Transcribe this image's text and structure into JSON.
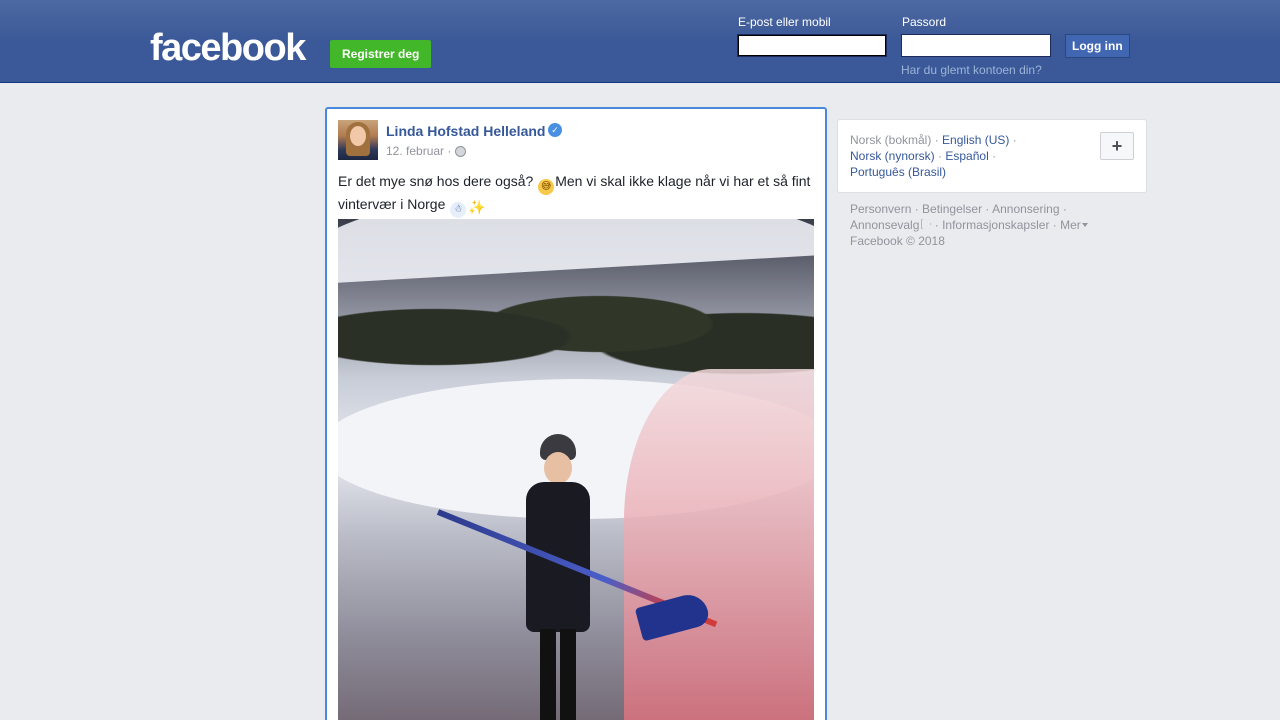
{
  "header": {
    "logo_text": "facebook",
    "register_label": "Registrer deg",
    "email_label": "E-post eller mobil",
    "email_value": "",
    "password_label": "Passord",
    "password_value": "",
    "login_label": "Logg inn",
    "forgot_label": "Har du glemt kontoen din?"
  },
  "post": {
    "author": "Linda Hofstad Helleland",
    "verified": true,
    "date": "12. februar",
    "date_separator": "·",
    "text_part1": "Er det mye snø hos dere også?",
    "text_part2": "Men vi skal ikke klage når vi har et så fint vintervær i Norge",
    "emojis": [
      "grinning-sweat-emoji",
      "snowman-emoji",
      "sparkles-emoji"
    ]
  },
  "languages": {
    "current": "Norsk (bokmål)",
    "links": [
      "English (US)",
      "Norsk (nynorsk)",
      "Español",
      "Português (Brasil)"
    ],
    "more_label": "+"
  },
  "footer": {
    "links": [
      "Personvern",
      "Betingelser",
      "Annonsering",
      "Annonsevalg",
      "Informasjonskapsler",
      "Mer"
    ],
    "copyright": "Facebook © 2018"
  },
  "colors": {
    "header_bg": "#3b5998",
    "link": "#365899",
    "register_green": "#42b72a",
    "page_bg": "#e9ebee"
  }
}
